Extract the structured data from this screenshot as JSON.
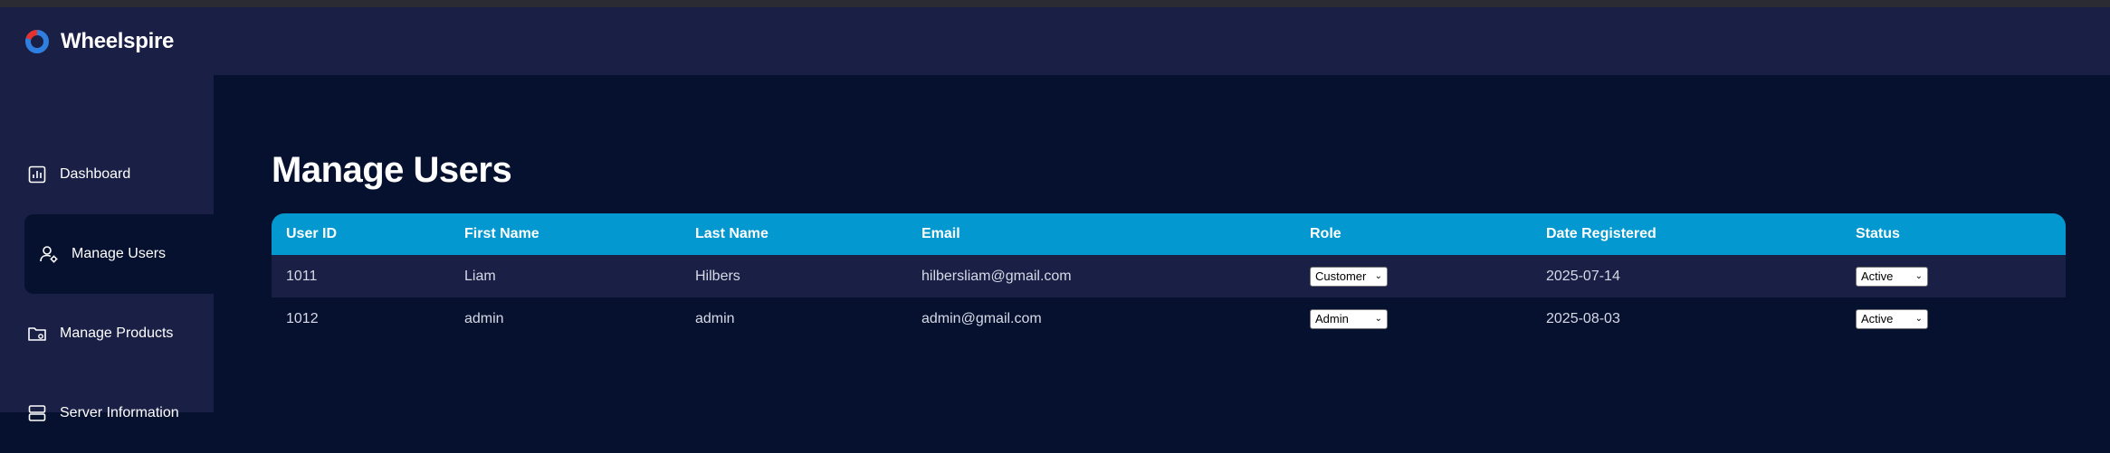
{
  "app": {
    "brand": "Wheelspire"
  },
  "colors": {
    "accent": "#0398cf",
    "header_bg": "#1a1f45",
    "main_bg": "#06112f",
    "logo_red": "#e5322d",
    "logo_blue": "#2f7fe0"
  },
  "sidebar": {
    "items": [
      {
        "label": "Dashboard",
        "icon": "bar-chart-icon"
      },
      {
        "label": "Manage Users",
        "icon": "user-gear-icon",
        "active": true
      },
      {
        "label": "Manage Products",
        "icon": "folder-gear-icon"
      },
      {
        "label": "Server Information",
        "icon": "server-icon"
      }
    ]
  },
  "main": {
    "title": "Manage Users",
    "table": {
      "headers": [
        "User ID",
        "First Name",
        "Last Name",
        "Email",
        "Role",
        "Date Registered",
        "Status"
      ],
      "rows": [
        {
          "id": "1011",
          "first": "Liam",
          "last": "Hilbers",
          "email": "hilbersliam@gmail.com",
          "role": "Customer",
          "date": "2025-07-14",
          "status": "Active"
        },
        {
          "id": "1012",
          "first": "admin",
          "last": "admin",
          "email": "admin@gmail.com",
          "role": "Admin",
          "date": "2025-08-03",
          "status": "Active"
        }
      ]
    }
  }
}
